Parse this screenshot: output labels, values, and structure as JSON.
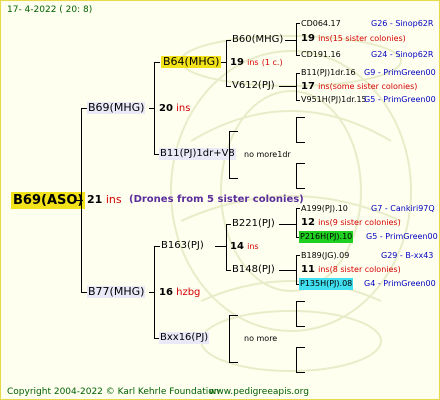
{
  "header": {
    "date": "17-  4-2022  ( 20:  8)"
  },
  "footer": {
    "copyright": "Copyright 2004-2022 © Karl Kehrle Foundation",
    "website": "www.pedigreeapis.org"
  },
  "root": {
    "id": "B69(ASO)",
    "num": "21",
    "ins": "ins",
    "note": "(Drones from 5 sister colonies)"
  },
  "gen1": {
    "upper": {
      "id": "B69(MHG)",
      "num": "20",
      "ins": "ins"
    },
    "lower": {
      "id": "B77(MHG)",
      "num": "16",
      "ins": "hzbg"
    }
  },
  "gen2": {
    "a": {
      "id": "B64(MHG)",
      "num": "19",
      "ins": "ins",
      "note": "(1 c.)"
    },
    "b": {
      "id": "B11(PJ)1dr+V8",
      "note": "no more1dr"
    },
    "c": {
      "id": "B163(PJ)",
      "num": "14",
      "ins": "ins"
    },
    "d": {
      "id": "Bxx16(PJ)",
      "note": "no more"
    }
  },
  "gen3": {
    "a": {
      "id": "B60(MHG)"
    },
    "b": {
      "id": "V612(PJ)"
    },
    "c": {
      "id": "B221(PJ)"
    },
    "d": {
      "id": "B148(PJ)"
    }
  },
  "gen4": {
    "r1": {
      "id": "CD064.17",
      "info": "G26 - Sinop62R"
    },
    "r2": {
      "num": "19",
      "ins": "ins",
      "note": "(15 sister colonies)"
    },
    "r3": {
      "id": "CD191.16",
      "info": "G24 - Sinop62R"
    },
    "r4": {
      "id": "B11(PJ)1dr.16",
      "info": "G9 - PrimGreen00"
    },
    "r5": {
      "num": "17",
      "ins": "ins",
      "note": "(some sister colonies)"
    },
    "r6": {
      "id": "V951H(PJ)1dr.15",
      "info": "G5 - PrimGreen00"
    },
    "r7": {
      "id": "A199(PJ).10",
      "info": "G7 - Cankiri97Q"
    },
    "r8": {
      "num": "12",
      "ins": "ins",
      "note": "(9 sister colonies)"
    },
    "r9": {
      "id": "P216H(PJ).10",
      "info": "G5 - PrimGreen00"
    },
    "r10": {
      "id": "B189(JG).09",
      "info": "G29 - B-xx43"
    },
    "r11": {
      "num": "11",
      "ins": "ins",
      "note": "(8 sister colonies)"
    },
    "r12": {
      "id": "P135H(PJ).08",
      "info": "G4 - PrimGreen00"
    }
  }
}
